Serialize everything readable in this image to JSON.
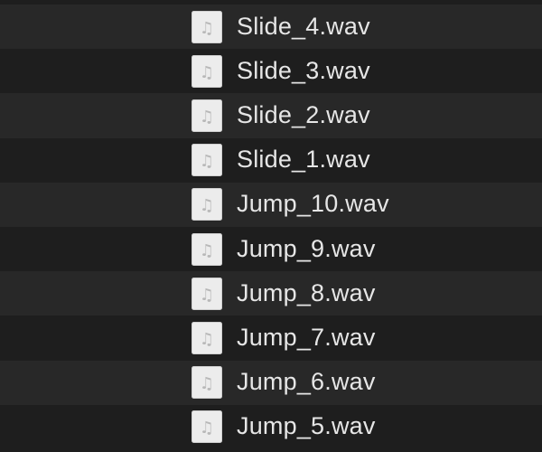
{
  "files": [
    {
      "name": "Slide_4.wav",
      "icon": "audio-file-icon"
    },
    {
      "name": "Slide_3.wav",
      "icon": "audio-file-icon"
    },
    {
      "name": "Slide_2.wav",
      "icon": "audio-file-icon"
    },
    {
      "name": "Slide_1.wav",
      "icon": "audio-file-icon"
    },
    {
      "name": "Jump_10.wav",
      "icon": "audio-file-icon"
    },
    {
      "name": "Jump_9.wav",
      "icon": "audio-file-icon"
    },
    {
      "name": "Jump_8.wav",
      "icon": "audio-file-icon"
    },
    {
      "name": "Jump_7.wav",
      "icon": "audio-file-icon"
    },
    {
      "name": "Jump_6.wav",
      "icon": "audio-file-icon"
    },
    {
      "name": "Jump_5.wav",
      "icon": "audio-file-icon"
    }
  ],
  "colors": {
    "background": "#1e1e1e",
    "row_alt": "#282828",
    "text": "#e6e6e6",
    "icon_bg": "#ececec",
    "icon_glyph": "#b8b8b8"
  }
}
